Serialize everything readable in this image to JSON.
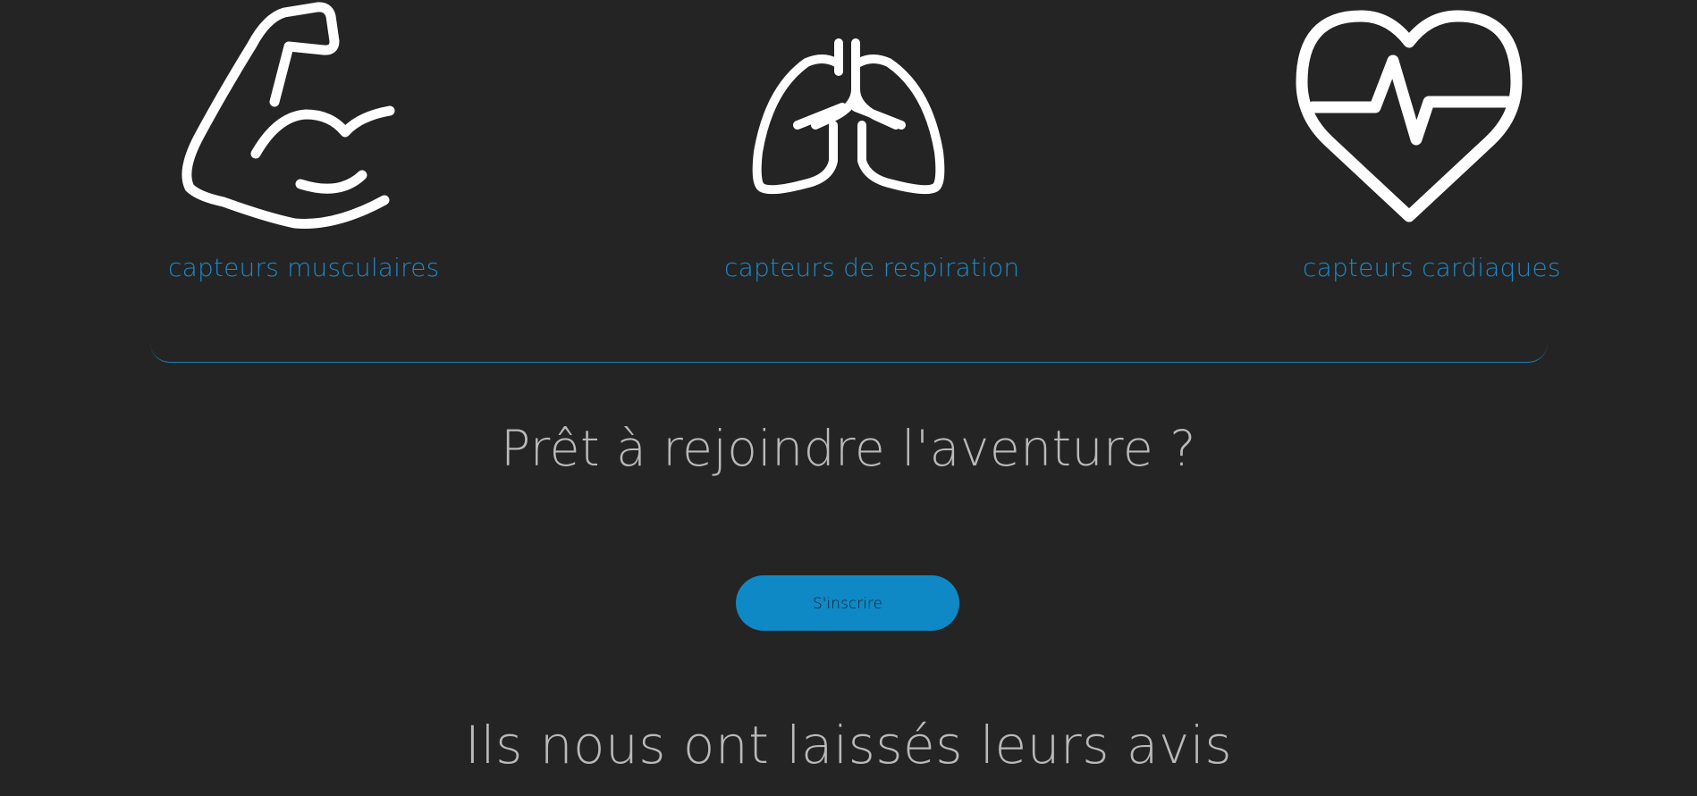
{
  "features": {
    "items": [
      {
        "icon": "flexed-arm-icon",
        "label": "capteurs musculaires"
      },
      {
        "icon": "lungs-icon",
        "label": "capteurs de respiration"
      },
      {
        "icon": "heartbeat-icon",
        "label": "capteurs cardiaques"
      }
    ]
  },
  "cta": {
    "heading": "Prêt à rejoindre l'aventure ?",
    "button_label": "S'inscrire"
  },
  "reviews": {
    "heading": "Ils nous ont laissés leurs avis"
  },
  "colors": {
    "background": "#242424",
    "accent": "#1b8acb",
    "button": "#0f89c6",
    "heading_text": "#b9b9b9",
    "icon_stroke": "#ffffff"
  }
}
